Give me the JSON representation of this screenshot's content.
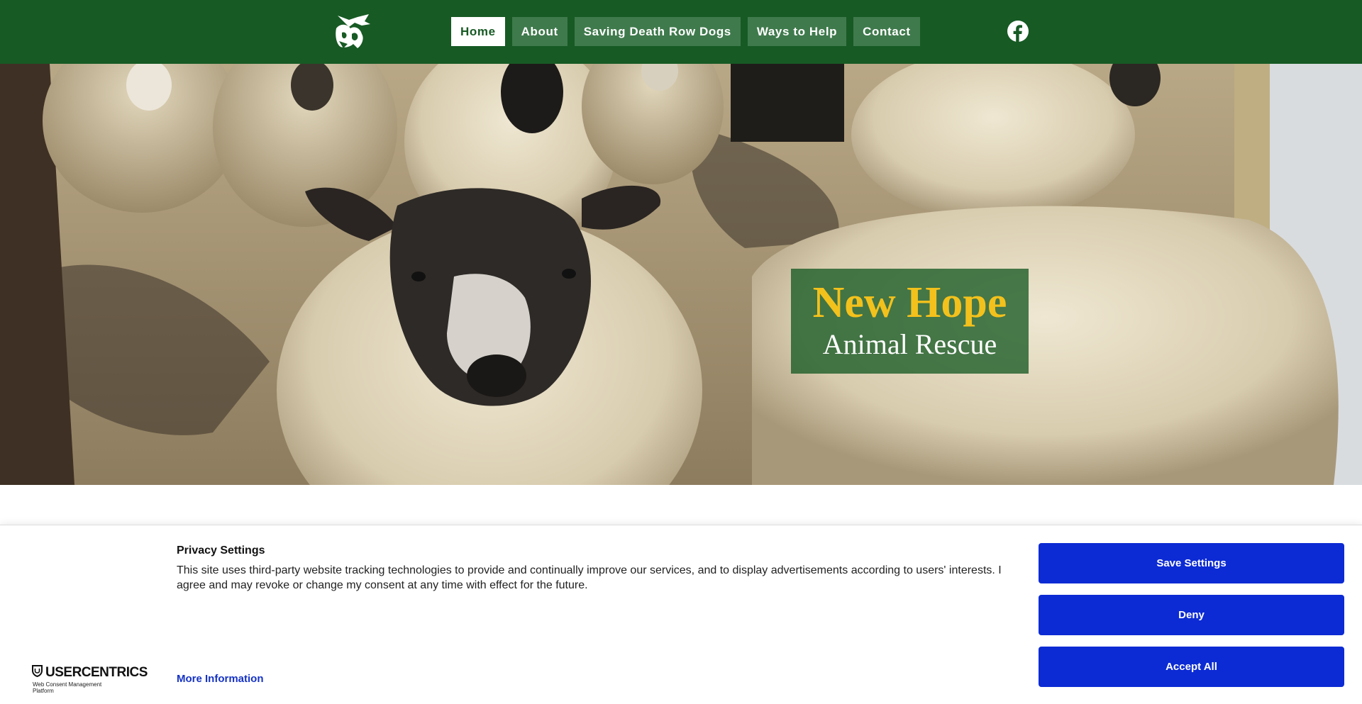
{
  "header": {
    "logo_icon": "rescue-logo-icon",
    "nav": [
      {
        "label": "Home",
        "active": true
      },
      {
        "label": "About"
      },
      {
        "label": "Saving Death Row Dogs"
      },
      {
        "label": "Ways to Help"
      },
      {
        "label": "Contact"
      }
    ],
    "social_icon": "facebook-icon"
  },
  "hero": {
    "title": "New Hope",
    "subtitle": "Animal Rescue",
    "image_subject": "flock of sheep"
  },
  "cookie_banner": {
    "brand": "USERCENTRICS",
    "brand_sub": "Web Consent Management Platform",
    "title": "Privacy Settings",
    "text": "This site uses third-party website tracking technologies to provide and continually improve our services, and to display advertisements according to users' interests. I agree and may revoke or change my consent at any time with effect for the future.",
    "more_info": "More Information",
    "buttons": {
      "save": "Save Settings",
      "deny": "Deny",
      "accept": "Accept All"
    }
  },
  "colors": {
    "header_bg": "#175a24",
    "nav_bg": "#3f7a4c",
    "title_yellow": "#f3c11c",
    "button_blue": "#0c2bd4",
    "link_blue": "#1532c5"
  }
}
